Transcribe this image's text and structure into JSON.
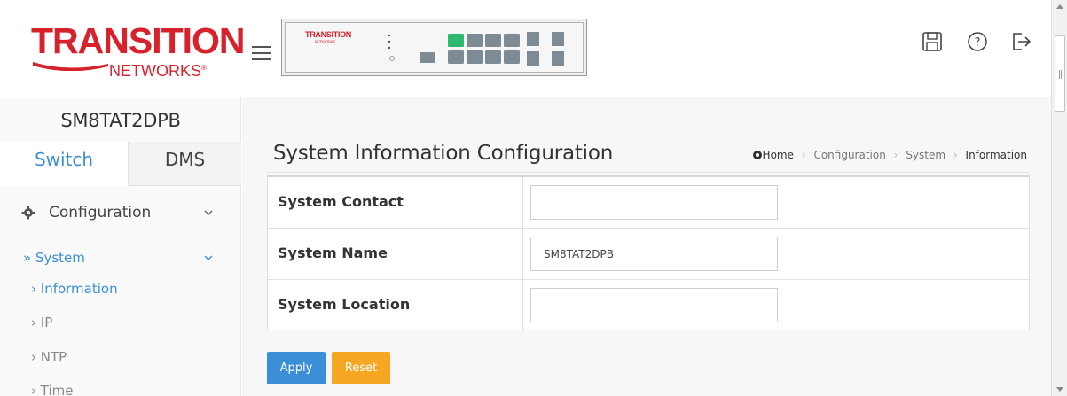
{
  "header": {
    "logo_top": "TRANSITION",
    "logo_bottom": "NETWORKS",
    "logo_reg": "®",
    "device_brand": "TRANSITION",
    "device_brand_sub": "NETWORKS",
    "icons": [
      "save-icon",
      "help-icon",
      "logout-icon"
    ]
  },
  "sidebar": {
    "device_name": "SM8TAT2DPB",
    "tabs": [
      {
        "label": "Switch",
        "active": true
      },
      {
        "label": "DMS",
        "active": false
      }
    ],
    "config_label": "Configuration",
    "system_label": "» System",
    "sub_items": [
      {
        "label": "› Information",
        "active": true
      },
      {
        "label": "› IP",
        "active": false
      },
      {
        "label": "› NTP",
        "active": false
      },
      {
        "label": "› Time",
        "active": false
      }
    ]
  },
  "main": {
    "title": "System Information Configuration",
    "breadcrumb": {
      "home": "Home",
      "items": [
        "Configuration",
        "System"
      ],
      "current": "Information"
    },
    "fields": [
      {
        "label": "System Contact",
        "value": ""
      },
      {
        "label": "System Name",
        "value": "SM8TAT2DPB"
      },
      {
        "label": "System Location",
        "value": ""
      }
    ],
    "buttons": {
      "apply": "Apply",
      "reset": "Reset"
    }
  },
  "colors": {
    "accent": "#3a8fd6",
    "brand_red": "#d7212b",
    "reset_orange": "#f5a623",
    "port_active": "#2eb872",
    "port_idle": "#7e8a94"
  }
}
